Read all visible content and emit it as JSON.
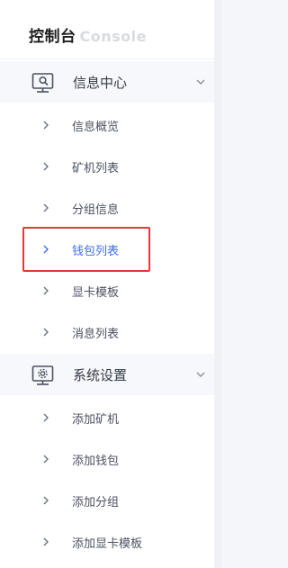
{
  "brand": {
    "title_cn": "控制台",
    "title_en": "Console"
  },
  "groups": [
    {
      "label": "信息中心",
      "icon": "monitor-report-icon",
      "items": [
        {
          "label": "信息概览"
        },
        {
          "label": "矿机列表"
        },
        {
          "label": "分组信息"
        },
        {
          "label": "钱包列表",
          "active": true
        },
        {
          "label": "显卡模板"
        },
        {
          "label": "消息列表"
        }
      ]
    },
    {
      "label": "系统设置",
      "icon": "monitor-gear-icon",
      "items": [
        {
          "label": "添加矿机"
        },
        {
          "label": "添加钱包"
        },
        {
          "label": "添加分组"
        },
        {
          "label": "添加显卡模板"
        }
      ]
    }
  ],
  "colors": {
    "active": "#3d6fe6",
    "highlight_border": "#e53935",
    "text": "#4a5160",
    "group_bg": "#f7f8fb"
  }
}
